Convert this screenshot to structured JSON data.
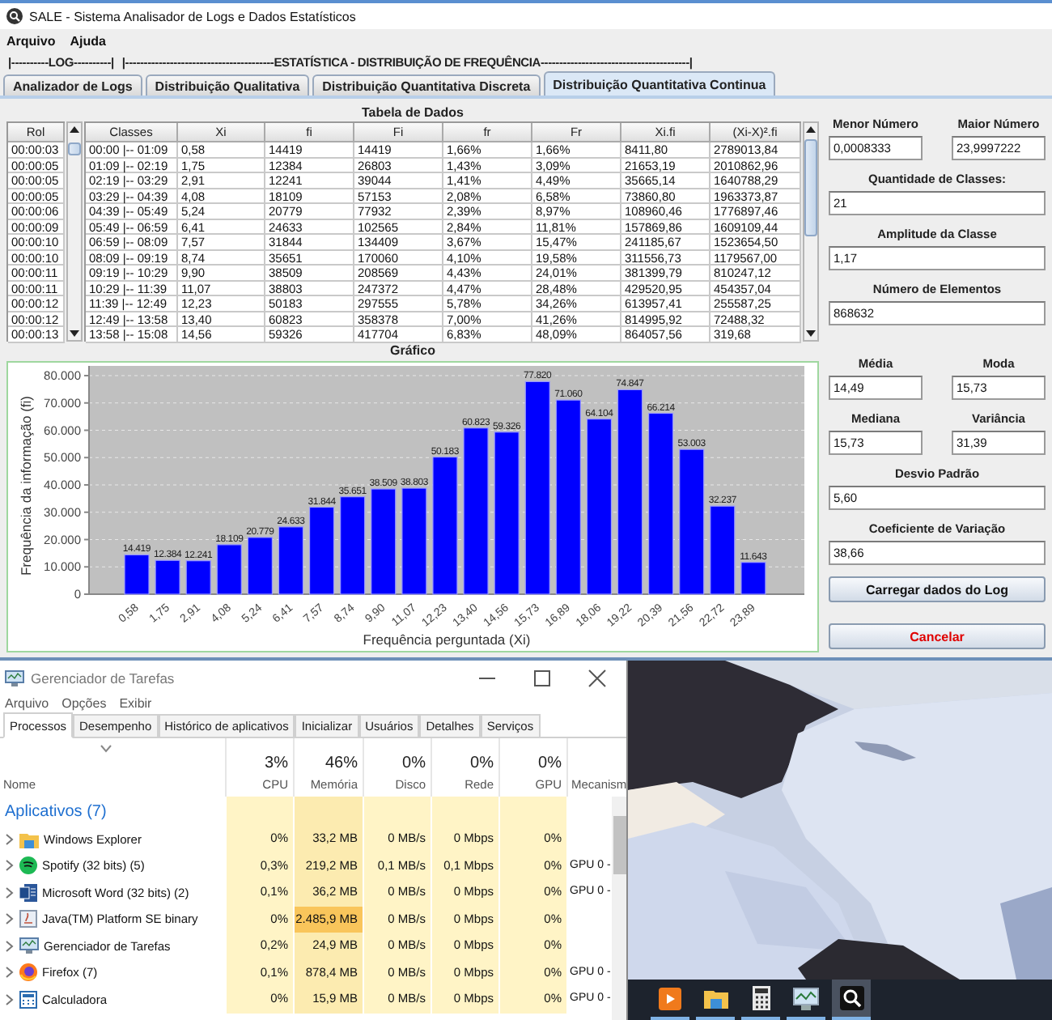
{
  "window": {
    "title": "SALE - Sistema Analisador de Logs e Dados Estatísticos",
    "menu": [
      "Arquivo",
      "Ajuda"
    ],
    "section_headers": [
      "|----------LOG----------|",
      "|----------------------------------------ESTATÍSTICA - DISTRIBUIÇÃO DE FREQUÊNCIA----------------------------------------|"
    ]
  },
  "tabs": [
    {
      "label": "Analizador de Logs",
      "selected": false
    },
    {
      "label": "Distribuição Qualitativa",
      "selected": false
    },
    {
      "label": "Distribuição Quantitativa Discreta",
      "selected": false
    },
    {
      "label": "Distribuição Quantitativa Continua",
      "selected": true
    }
  ],
  "data_table": {
    "title": "Tabela de Dados",
    "rol": {
      "header": "Rol",
      "values": [
        "00:00:03",
        "00:00:05",
        "00:00:05",
        "00:00:05",
        "00:00:06",
        "00:00:09",
        "00:00:10",
        "00:00:10",
        "00:00:11",
        "00:00:11",
        "00:00:12",
        "00:00:12",
        "00:00:13"
      ]
    },
    "columns": [
      "Classes",
      "Xi",
      "fi",
      "Fi",
      "fr",
      "Fr",
      "Xi.fi",
      "(Xi-X)².fi"
    ],
    "rows": [
      [
        "00:00 |-- 01:09",
        "0,58",
        "14419",
        "14419",
        "1,66%",
        "1,66%",
        "8411,80",
        "2789013,84"
      ],
      [
        "01:09 |-- 02:19",
        "1,75",
        "12384",
        "26803",
        "1,43%",
        "3,09%",
        "21653,19",
        "2010862,96"
      ],
      [
        "02:19 |-- 03:29",
        "2,91",
        "12241",
        "39044",
        "1,41%",
        "4,49%",
        "35665,14",
        "1640788,29"
      ],
      [
        "03:29 |-- 04:39",
        "4,08",
        "18109",
        "57153",
        "2,08%",
        "6,58%",
        "73860,80",
        "1963373,87"
      ],
      [
        "04:39 |-- 05:49",
        "5,24",
        "20779",
        "77932",
        "2,39%",
        "8,97%",
        "108960,46",
        "1776897,46"
      ],
      [
        "05:49 |-- 06:59",
        "6,41",
        "24633",
        "102565",
        "2,84%",
        "11,81%",
        "157869,86",
        "1609109,44"
      ],
      [
        "06:59 |-- 08:09",
        "7,57",
        "31844",
        "134409",
        "3,67%",
        "15,47%",
        "241185,67",
        "1523654,50"
      ],
      [
        "08:09 |-- 09:19",
        "8,74",
        "35651",
        "170060",
        "4,10%",
        "19,58%",
        "311556,73",
        "1179567,00"
      ],
      [
        "09:19 |-- 10:29",
        "9,90",
        "38509",
        "208569",
        "4,43%",
        "24,01%",
        "381399,79",
        "810247,12"
      ],
      [
        "10:29 |-- 11:39",
        "11,07",
        "38803",
        "247372",
        "4,47%",
        "28,48%",
        "429520,95",
        "454357,04"
      ],
      [
        "11:39 |-- 12:49",
        "12,23",
        "50183",
        "297555",
        "5,78%",
        "34,26%",
        "613957,41",
        "255587,25"
      ],
      [
        "12:49 |-- 13:58",
        "13,40",
        "60823",
        "358378",
        "7,00%",
        "41,26%",
        "814995,92",
        "72488,32"
      ],
      [
        "13:58 |-- 15:08",
        "14,56",
        "59326",
        "417704",
        "6,83%",
        "48,09%",
        "864057,56",
        "319,68"
      ]
    ]
  },
  "chart": {
    "title": "Gráfico",
    "chart_data": {
      "type": "bar",
      "xlabel": "Frequência perguntada (Xi)",
      "ylabel": "Frequência da informação (fi)",
      "categories": [
        "0,58",
        "1,75",
        "2,91",
        "4,08",
        "5,24",
        "6,41",
        "7,57",
        "8,74",
        "9,90",
        "11,07",
        "12,23",
        "13,40",
        "14,56",
        "15,73",
        "16,89",
        "18,06",
        "19,22",
        "20,39",
        "21,56",
        "22,72",
        "23,89"
      ],
      "values": [
        14419,
        12384,
        12241,
        18109,
        20779,
        24633,
        31844,
        35651,
        38509,
        38803,
        50183,
        60823,
        59326,
        77820,
        71060,
        64104,
        74847,
        66214,
        53003,
        32237,
        11643
      ],
      "value_labels": [
        "14.419",
        "12.384",
        "12.241",
        "18.109",
        "20.779",
        "24.633",
        "31.844",
        "35.651",
        "38.509",
        "38.803",
        "50.183",
        "60.823",
        "59.326",
        "77.820",
        "71.060",
        "64.104",
        "74.847",
        "66.214",
        "53.003",
        "32.237",
        "11.643"
      ],
      "grid": true,
      "ylim": [
        0,
        80000
      ],
      "yticks": [
        {
          "value": 0,
          "label": "0"
        },
        {
          "value": 10000,
          "label": "10.000"
        },
        {
          "value": 20000,
          "label": "20.000"
        },
        {
          "value": 30000,
          "label": "30.000"
        },
        {
          "value": 40000,
          "label": "40.000"
        },
        {
          "value": 50000,
          "label": "50.000"
        },
        {
          "value": 60000,
          "label": "60.000"
        },
        {
          "value": 70000,
          "label": "70.000"
        },
        {
          "value": 80000,
          "label": "80.000"
        }
      ]
    }
  },
  "stats": {
    "rows": [
      [
        {
          "label": "Menor Número",
          "value": "0,0008333"
        },
        {
          "label": "Maior Número",
          "value": "23,9997222"
        }
      ],
      [
        {
          "label": "Quantidade de Classes:",
          "value": "21"
        }
      ],
      [
        {
          "label": "Amplitude da Classe",
          "value": "1,17"
        }
      ],
      [
        {
          "label": "Número de Elementos",
          "value": "868632"
        }
      ],
      [
        {
          "label": "Média",
          "value": "14,49"
        },
        {
          "label": "Moda",
          "value": "15,73"
        }
      ],
      [
        {
          "label": "Mediana",
          "value": "15,73"
        },
        {
          "label": "Variância",
          "value": "31,39"
        }
      ],
      [
        {
          "label": "Desvio Padrão",
          "value": "5,60"
        }
      ],
      [
        {
          "label": "Coeficiente de Variação",
          "value": "38,66"
        }
      ]
    ],
    "buttons": [
      {
        "label": "Carregar dados do Log",
        "kind": "normal"
      },
      {
        "label": "Cancelar",
        "kind": "cancel"
      }
    ]
  },
  "task_manager": {
    "title": "Gerenciador de Tarefas",
    "menu": [
      "Arquivo",
      "Opções",
      "Exibir"
    ],
    "tabs": [
      {
        "label": "Processos",
        "selected": true
      },
      {
        "label": "Desempenho",
        "selected": false
      },
      {
        "label": "Histórico de aplicativos",
        "selected": false
      },
      {
        "label": "Inicializar",
        "selected": false
      },
      {
        "label": "Usuários",
        "selected": false
      },
      {
        "label": "Detalhes",
        "selected": false
      },
      {
        "label": "Serviços",
        "selected": false
      }
    ],
    "columns": [
      {
        "label": "Nome"
      },
      {
        "label": "CPU",
        "usage": "3%"
      },
      {
        "label": "Memória",
        "usage": "46%"
      },
      {
        "label": "Disco",
        "usage": "0%"
      },
      {
        "label": "Rede",
        "usage": "0%"
      },
      {
        "label": "GPU",
        "usage": "0%"
      },
      {
        "label": "Mecanism"
      }
    ],
    "group": "Aplicativos (7)",
    "rows": [
      {
        "name": "Windows Explorer",
        "cpu": "0%",
        "memory": "33,2 MB",
        "disk": "0 MB/s",
        "network": "0 Mbps",
        "gpu": "0%",
        "expanded": false,
        "memory_hot": false
      },
      {
        "name": "Spotify (32 bits) (5)",
        "cpu": "0,3%",
        "memory": "219,2 MB",
        "disk": "0,1 MB/s",
        "network": "0,1 Mbps",
        "gpu": "0%",
        "engine": "GPU 0 -",
        "expanded": false,
        "memory_hot": false
      },
      {
        "name": "Microsoft Word (32 bits) (2)",
        "cpu": "0,1%",
        "memory": "36,2 MB",
        "disk": "0 MB/s",
        "network": "0 Mbps",
        "gpu": "0%",
        "engine": "GPU 0 -",
        "expanded": false,
        "memory_hot": false
      },
      {
        "name": "Java(TM) Platform SE binary",
        "cpu": "0%",
        "memory": "2.485,9 MB",
        "disk": "0 MB/s",
        "network": "0 Mbps",
        "gpu": "0%",
        "expanded": false,
        "memory_hot": true
      },
      {
        "name": "Gerenciador de Tarefas",
        "cpu": "0,2%",
        "memory": "24,9 MB",
        "disk": "0 MB/s",
        "network": "0 Mbps",
        "gpu": "0%",
        "expanded": false,
        "memory_hot": false
      },
      {
        "name": "Firefox (7)",
        "cpu": "0,1%",
        "memory": "878,4 MB",
        "disk": "0 MB/s",
        "network": "0 Mbps",
        "gpu": "0%",
        "engine": "GPU 0 -",
        "expanded": false,
        "memory_hot": false
      },
      {
        "name": "Calculadora",
        "cpu": "0%",
        "memory": "15,9 MB",
        "disk": "0 MB/s",
        "network": "0 Mbps",
        "gpu": "0%",
        "engine": "GPU 0 -",
        "expanded": false,
        "memory_hot": false
      }
    ]
  }
}
